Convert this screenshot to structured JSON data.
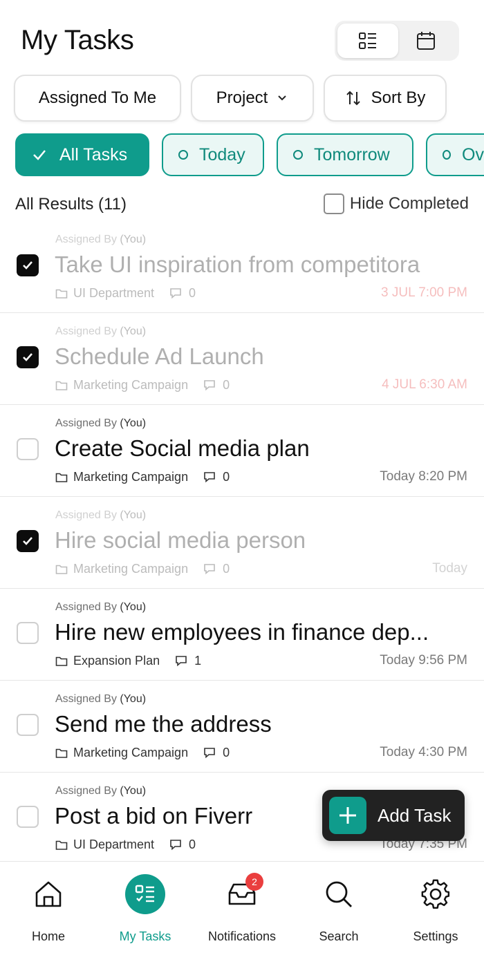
{
  "header": {
    "title": "My Tasks",
    "view_icons": [
      "list-view-icon",
      "calendar-icon"
    ]
  },
  "filters": {
    "assigned": "Assigned To Me",
    "project": "Project",
    "sort": "Sort By"
  },
  "chips": {
    "all": "All Tasks",
    "today": "Today",
    "tomorrow": "Tomorrow",
    "overdue": "Ov"
  },
  "results": {
    "count_label": "All Results (11)",
    "hide_completed": "Hide Completed",
    "hide_completed_checked": false
  },
  "tasks": [
    {
      "assigned_label": "Assigned By",
      "assigned_by": "(You)",
      "title": "Take UI inspiration from competitora",
      "project": "UI Department",
      "comments": "0",
      "date": "3 JUL  7:00 PM",
      "done": true,
      "overdue": true
    },
    {
      "assigned_label": "Assigned By",
      "assigned_by": "(You)",
      "title": "Schedule Ad Launch",
      "project": "Marketing Campaign",
      "comments": "0",
      "date": "4 JUL  6:30 AM",
      "done": true,
      "overdue": true
    },
    {
      "assigned_label": "Assigned By",
      "assigned_by": "(You)",
      "title": "Create Social media plan",
      "project": "Marketing Campaign",
      "comments": "0",
      "date": "Today  8:20 PM",
      "done": false,
      "overdue": false
    },
    {
      "assigned_label": "Assigned By",
      "assigned_by": "(You)",
      "title": "Hire social media person",
      "project": "Marketing Campaign",
      "comments": "0",
      "date": "Today",
      "done": true,
      "overdue": false
    },
    {
      "assigned_label": "Assigned By",
      "assigned_by": "(You)",
      "title": "Hire new employees in finance dep...",
      "project": "Expansion Plan",
      "comments": "1",
      "date": "Today  9:56 PM",
      "done": false,
      "overdue": false
    },
    {
      "assigned_label": "Assigned By",
      "assigned_by": "(You)",
      "title": "Send me the address",
      "project": "Marketing Campaign",
      "comments": "0",
      "date": "Today  4:30 PM",
      "done": false,
      "overdue": false
    },
    {
      "assigned_label": "Assigned By",
      "assigned_by": "(You)",
      "title": "Post a bid on Fiverr",
      "project": "UI Department",
      "comments": "0",
      "date": "Today  7:35 PM",
      "done": false,
      "overdue": false
    }
  ],
  "fab": {
    "label": "Add Task"
  },
  "nav": {
    "home": "Home",
    "tasks": "My Tasks",
    "notifications": "Notifications",
    "notifications_badge": "2",
    "search": "Search",
    "settings": "Settings"
  },
  "colors": {
    "accent": "#0f9c8c",
    "overdue": "#e23b3b",
    "fab_bg": "#222222",
    "badge": "#ea3e3e"
  }
}
